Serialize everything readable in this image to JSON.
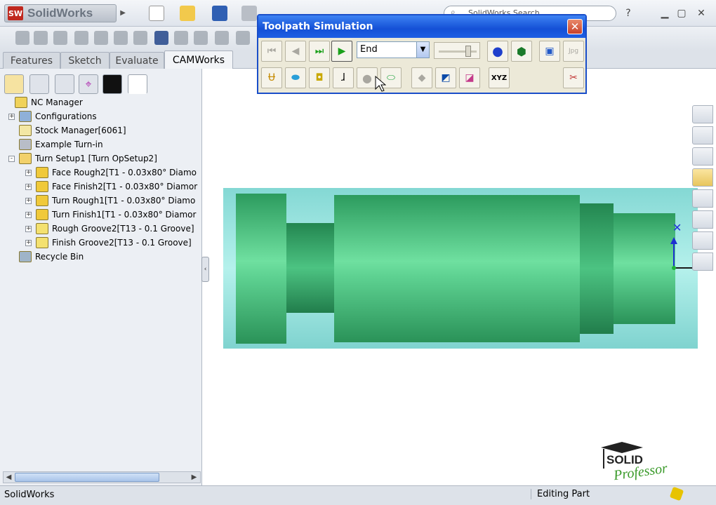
{
  "app": {
    "logo_badge": "SW",
    "logo_text": "SolidWorks",
    "search_placeholder": "SolidWorks Search",
    "help": "?"
  },
  "tabs": [
    "Features",
    "Sketch",
    "Evaluate",
    "CAMWorks"
  ],
  "tree": [
    {
      "label": "NC Manager",
      "level": 0,
      "expander": "",
      "icon": "nc-manager-icon"
    },
    {
      "label": "Configurations",
      "level": 1,
      "expander": "+",
      "icon": "configurations-icon"
    },
    {
      "label": "Stock Manager[6061]",
      "level": 1,
      "expander": "",
      "icon": "stock-manager-icon"
    },
    {
      "label": "Example Turn-in",
      "level": 1,
      "expander": "",
      "icon": "machine-icon"
    },
    {
      "label": "Turn Setup1 [Turn OpSetup2]",
      "level": 1,
      "expander": "-",
      "icon": "turn-setup-icon"
    },
    {
      "label": "Face Rough2[T1 - 0.03x80° Diamo",
      "level": 2,
      "expander": "+",
      "icon": "turn-operation-icon"
    },
    {
      "label": "Face Finish2[T1 - 0.03x80° Diamor",
      "level": 2,
      "expander": "+",
      "icon": "turn-operation-icon"
    },
    {
      "label": "Turn Rough1[T1 - 0.03x80° Diamo",
      "level": 2,
      "expander": "+",
      "icon": "turn-operation-icon"
    },
    {
      "label": "Turn Finish1[T1 - 0.03x80° Diamor",
      "level": 2,
      "expander": "+",
      "icon": "turn-operation-icon"
    },
    {
      "label": "Rough Groove2[T13 - 0.1 Groove]",
      "level": 2,
      "expander": "+",
      "icon": "groove-operation-icon"
    },
    {
      "label": "Finish Groove2[T13 - 0.1 Groove]",
      "level": 2,
      "expander": "+",
      "icon": "groove-operation-icon"
    },
    {
      "label": "Recycle Bin",
      "level": 1,
      "expander": "",
      "icon": "recycle-bin-icon"
    }
  ],
  "dialog": {
    "title": "Toolpath Simulation",
    "close": "✕",
    "mode": "End",
    "xyz": "XYZ",
    "faded_label": "Jpg"
  },
  "status": {
    "left": "SolidWorks",
    "right": "Editing Part"
  },
  "branding": {
    "line1": "SOLID",
    "line2": "Professor"
  },
  "colors": {
    "part_green": "#3fbf78",
    "stock_cyan": "#8fe3de",
    "dialog_title": "#1450d6"
  }
}
